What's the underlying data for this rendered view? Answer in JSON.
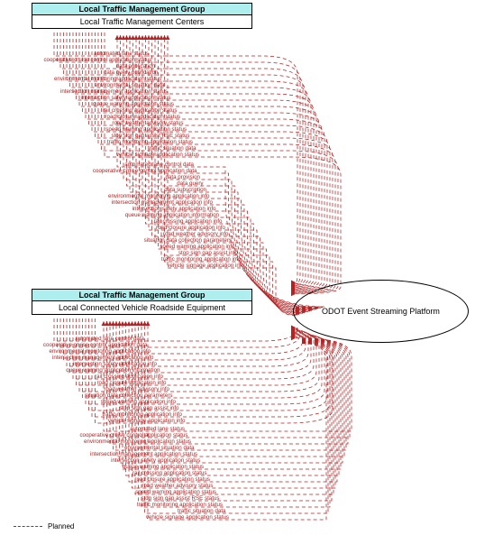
{
  "nodes": {
    "A": {
      "group": "Local Traffic Management Group",
      "title": "Local Traffic Management Centers"
    },
    "B": {
      "group": "Local Traffic Management Group",
      "title": "Local Connected Vehicle Roadside Equipment"
    },
    "C": {
      "title": "ODOT Event Streaming Platform"
    }
  },
  "legend": {
    "label": "Planned"
  },
  "flows": {
    "A_to_C": [
      "automated lane status",
      "cooperative cruise control application status",
      "data publication",
      "data query publication",
      "environmental monitoring application status",
      "environmental situation data",
      "intersection management application status",
      "intersection safety application status",
      "queue warning application status",
      "rail crossing application status",
      "road closure application status",
      "road weather advisory status",
      "speed warning application status",
      "stop sign gap assist RSE status",
      "traffic monitoring application status",
      "traffic situation data",
      "vehicle signage application status"
    ],
    "C_to_A": [
      "automated lane control data",
      "cooperative cruise control application data",
      "data provision",
      "data query",
      "data subscription",
      "environmental monitoring application info",
      "intersection management application info",
      "intersection safety application info",
      "queue warning application information",
      "rail crossing application info",
      "road closure application info",
      "road weather advisory info",
      "situation data collection parameters",
      "speed warning application info",
      "stop sign gap assist info",
      "traffic monitoring application info",
      "vehicle signage application info"
    ],
    "B_to_C": [
      "automated lane control data",
      "cooperative cruise control application data",
      "environmental monitoring application info",
      "intersection management application info",
      "intersection safety application info",
      "queue warning application information",
      "rail crossing application info",
      "road closure application info",
      "road weather advisory info",
      "situation data collection parameters",
      "speed warning application info",
      "stop sign gap assist info",
      "traffic monitoring application info",
      "vehicle signage application info"
    ],
    "C_to_B": [
      "automated lane status",
      "cooperative cruise control application status",
      "environmental monitoring application status",
      "environmental situation data",
      "intersection management application status",
      "intersection safety application status",
      "queue warning application status",
      "rail crossing application status",
      "road closure application status",
      "road weather advisory status",
      "speed warning application status",
      "stop sign gap assist RSE status",
      "traffic monitoring application status",
      "traffic situation data",
      "vehicle signage application status"
    ]
  },
  "chart_data": {
    "type": "diagram",
    "title": "",
    "note": "Architecture flow diagram: two local traffic management elements exchange planned data flows with an ODOT Event Streaming Platform.",
    "legend": [
      "Planned"
    ]
  }
}
